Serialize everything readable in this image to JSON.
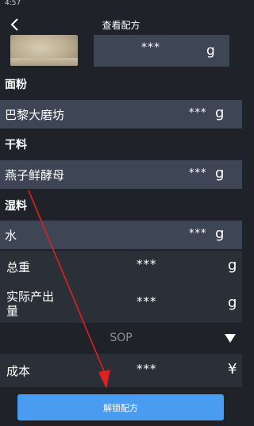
{
  "status_bar": {
    "time": "4:57"
  },
  "nav": {
    "title": "查看配方",
    "back_icon": "chevron-left-icon"
  },
  "hero": {
    "weight_value": "***",
    "weight_unit": "g"
  },
  "sections": [
    {
      "title": "面粉",
      "items": [
        {
          "name": "巴黎大磨坊",
          "value": "***",
          "unit": "g"
        }
      ]
    },
    {
      "title": "干料",
      "items": [
        {
          "name": "燕子鲜酵母",
          "value": "***",
          "unit": "g"
        }
      ]
    },
    {
      "title": "湿料",
      "items": [
        {
          "name": "水",
          "value": "***",
          "unit": "g"
        }
      ]
    }
  ],
  "summary": {
    "total_weight": {
      "label": "总重",
      "value": "***",
      "unit": "g"
    },
    "actual_output": {
      "label": "实际产出量",
      "label_line1": "实际产出",
      "label_line2": "量",
      "value": "***",
      "unit": "g"
    },
    "cost": {
      "label": "成本",
      "value": "***",
      "unit": "¥"
    }
  },
  "sop": {
    "label": "SOP",
    "icon": "triangle-down-icon"
  },
  "unlock_button": {
    "label": "解锁配方",
    "color": "#4a9cf0"
  },
  "annotation": {
    "color": "#e02020"
  }
}
